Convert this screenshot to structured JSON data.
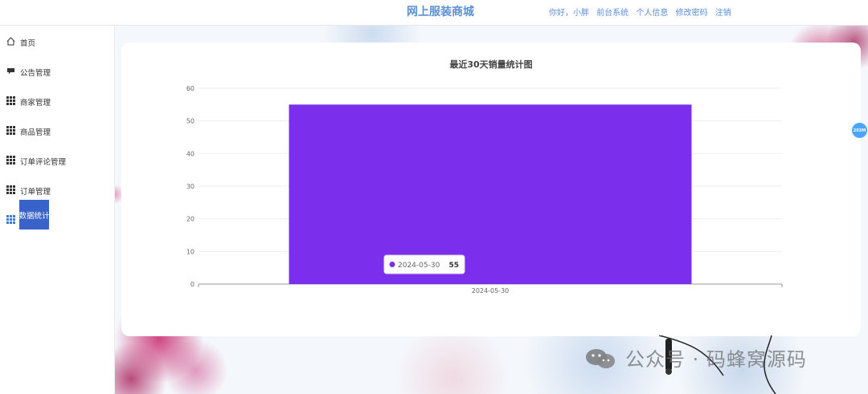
{
  "header": {
    "site_title": "网上服装商城",
    "greeting": "你好，小胖",
    "links": [
      "前台系统",
      "个人信息",
      "修改密码",
      "注销"
    ]
  },
  "sidebar": {
    "items": [
      {
        "label": "首页",
        "icon": "home-icon"
      },
      {
        "label": "公告管理",
        "icon": "message-icon"
      },
      {
        "label": "商家管理",
        "icon": "grid-icon"
      },
      {
        "label": "商品管理",
        "icon": "grid-icon"
      },
      {
        "label": "订单评论管理",
        "icon": "grid-icon"
      },
      {
        "label": "订单管理",
        "icon": "grid-icon"
      },
      {
        "label": "数据统计",
        "icon": "grid-icon",
        "active": true
      }
    ]
  },
  "float_button": {
    "label": "203M"
  },
  "watermark": {
    "text": "公众号 · 码蜂窝源码"
  },
  "colors": {
    "accent": "#3a63c9",
    "bar": "#7b2fec",
    "title": "#5b8fd6"
  },
  "chart_data": {
    "type": "bar",
    "title": "最近30天销量统计图",
    "categories": [
      "2024-05-30"
    ],
    "values": [
      55
    ],
    "ylim": [
      0,
      60
    ],
    "yticks": [
      0,
      10,
      20,
      30,
      40,
      50,
      60
    ],
    "tooltip": {
      "label": "2024-05-30",
      "value": "55"
    },
    "grid": true,
    "color": "#7b2fec"
  }
}
